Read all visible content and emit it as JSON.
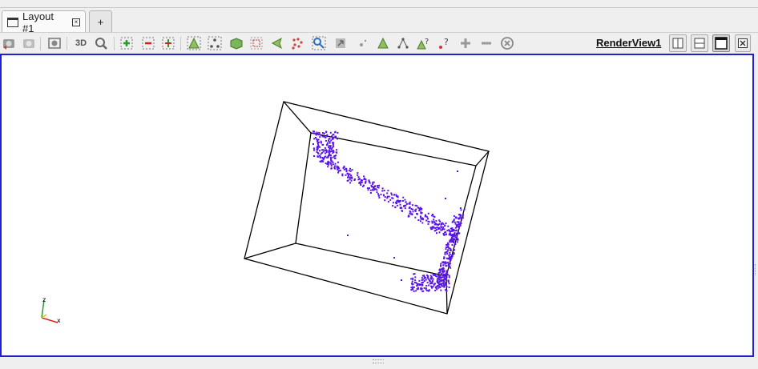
{
  "tabs": [
    {
      "label": "Layout #1",
      "icon": "window-icon",
      "close": "close-tab-icon"
    },
    {
      "label": "+",
      "icon": "add-layout-icon"
    }
  ],
  "toolbar": {
    "mode_3d_label": "3D",
    "view_name": "RenderView1",
    "icons": [
      "reset-camera-icon",
      "undo-camera-icon",
      "capture-screenshot-icon",
      "zoom-to-box-icon",
      "zoom-in-icon",
      "zoom-out-icon",
      "zoom-closest-icon",
      "select-cells-on-icon",
      "select-points-on-icon",
      "select-frustum-icon",
      "select-block-icon",
      "interactive-select-icon",
      "select-points-polygon-icon",
      "hover-points-icon",
      "grow-selection-icon",
      "shrink-selection-icon",
      "hover-cell-icon",
      "hover-point-icon",
      "query-icon",
      "clear-selection-icon"
    ],
    "layout_buttons": [
      "split-horizontal-icon",
      "split-vertical-icon",
      "maximize-icon",
      "close-view-icon"
    ]
  },
  "scene": {
    "point_color": "#5a14e8",
    "frame_color": "#000000",
    "view_border_color": "#1f1fd4",
    "axes": {
      "x_label": "x",
      "z_label": "z"
    }
  }
}
